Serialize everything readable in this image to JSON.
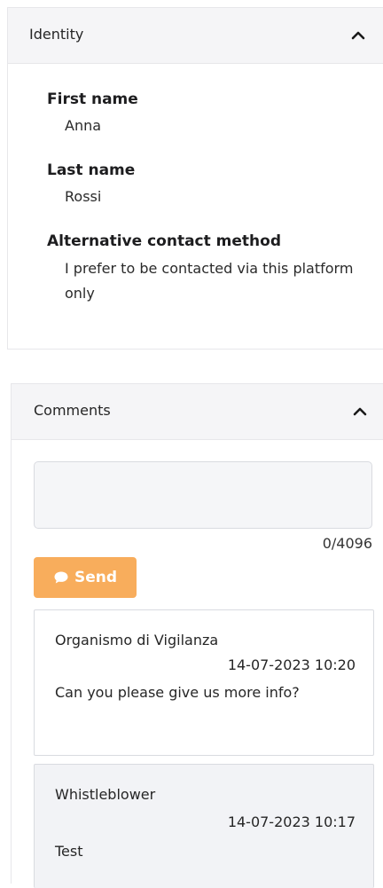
{
  "identity": {
    "title": "Identity",
    "fields": [
      {
        "label": "First name",
        "value": "Anna"
      },
      {
        "label": "Last name",
        "value": "Rossi"
      },
      {
        "label": "Alternative contact method",
        "value": "I prefer to be contacted via this platform only"
      }
    ]
  },
  "comments": {
    "title": "Comments",
    "input": {
      "value": "",
      "placeholder": ""
    },
    "counter": "0/4096",
    "send_label": "Send",
    "accent_color": "#f8ad5c",
    "items": [
      {
        "author": "Organismo di Vigilanza",
        "date": "14-07-2023 10:20",
        "text": "Can you please give us more info?"
      },
      {
        "author": "Whistleblower",
        "date": "14-07-2023 10:17",
        "text": "Test"
      }
    ]
  },
  "icons": {
    "collapse": "chevron-up-icon",
    "send": "chat-bubble-icon"
  }
}
